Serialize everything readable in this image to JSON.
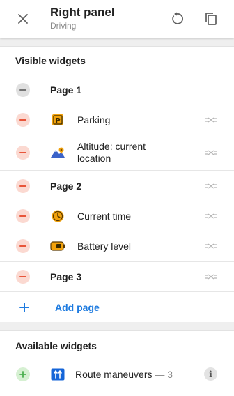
{
  "header": {
    "title": "Right panel",
    "subtitle": "Driving",
    "icons": {
      "close": "close-icon",
      "reset": "reset-icon",
      "copy": "copy-icon"
    }
  },
  "visible": {
    "title": "Visible widgets",
    "page1": {
      "label": "Page 1"
    },
    "parking": {
      "label": "Parking",
      "icon": "parking-icon",
      "color": "#f2a20c"
    },
    "altitude": {
      "label_line1": "Altitude: current",
      "label_line2": "location",
      "icon": "altitude-icon"
    },
    "page2": {
      "label": "Page 2"
    },
    "time": {
      "label": "Current time",
      "icon": "clock-icon",
      "color": "#f2a20c"
    },
    "battery": {
      "label": "Battery level",
      "icon": "battery-icon",
      "color": "#f2a20c"
    },
    "page3": {
      "label": "Page 3"
    },
    "add_page": {
      "label": "Add page"
    }
  },
  "available": {
    "title": "Available widgets",
    "route": {
      "label": "Route maneuvers",
      "dash": " — ",
      "count": "3",
      "icon": "route-maneuvers-icon",
      "color": "#1565d8"
    }
  },
  "colors": {
    "remove": "#e8553a",
    "add": "#4caf50",
    "accent": "#1e7be0"
  }
}
